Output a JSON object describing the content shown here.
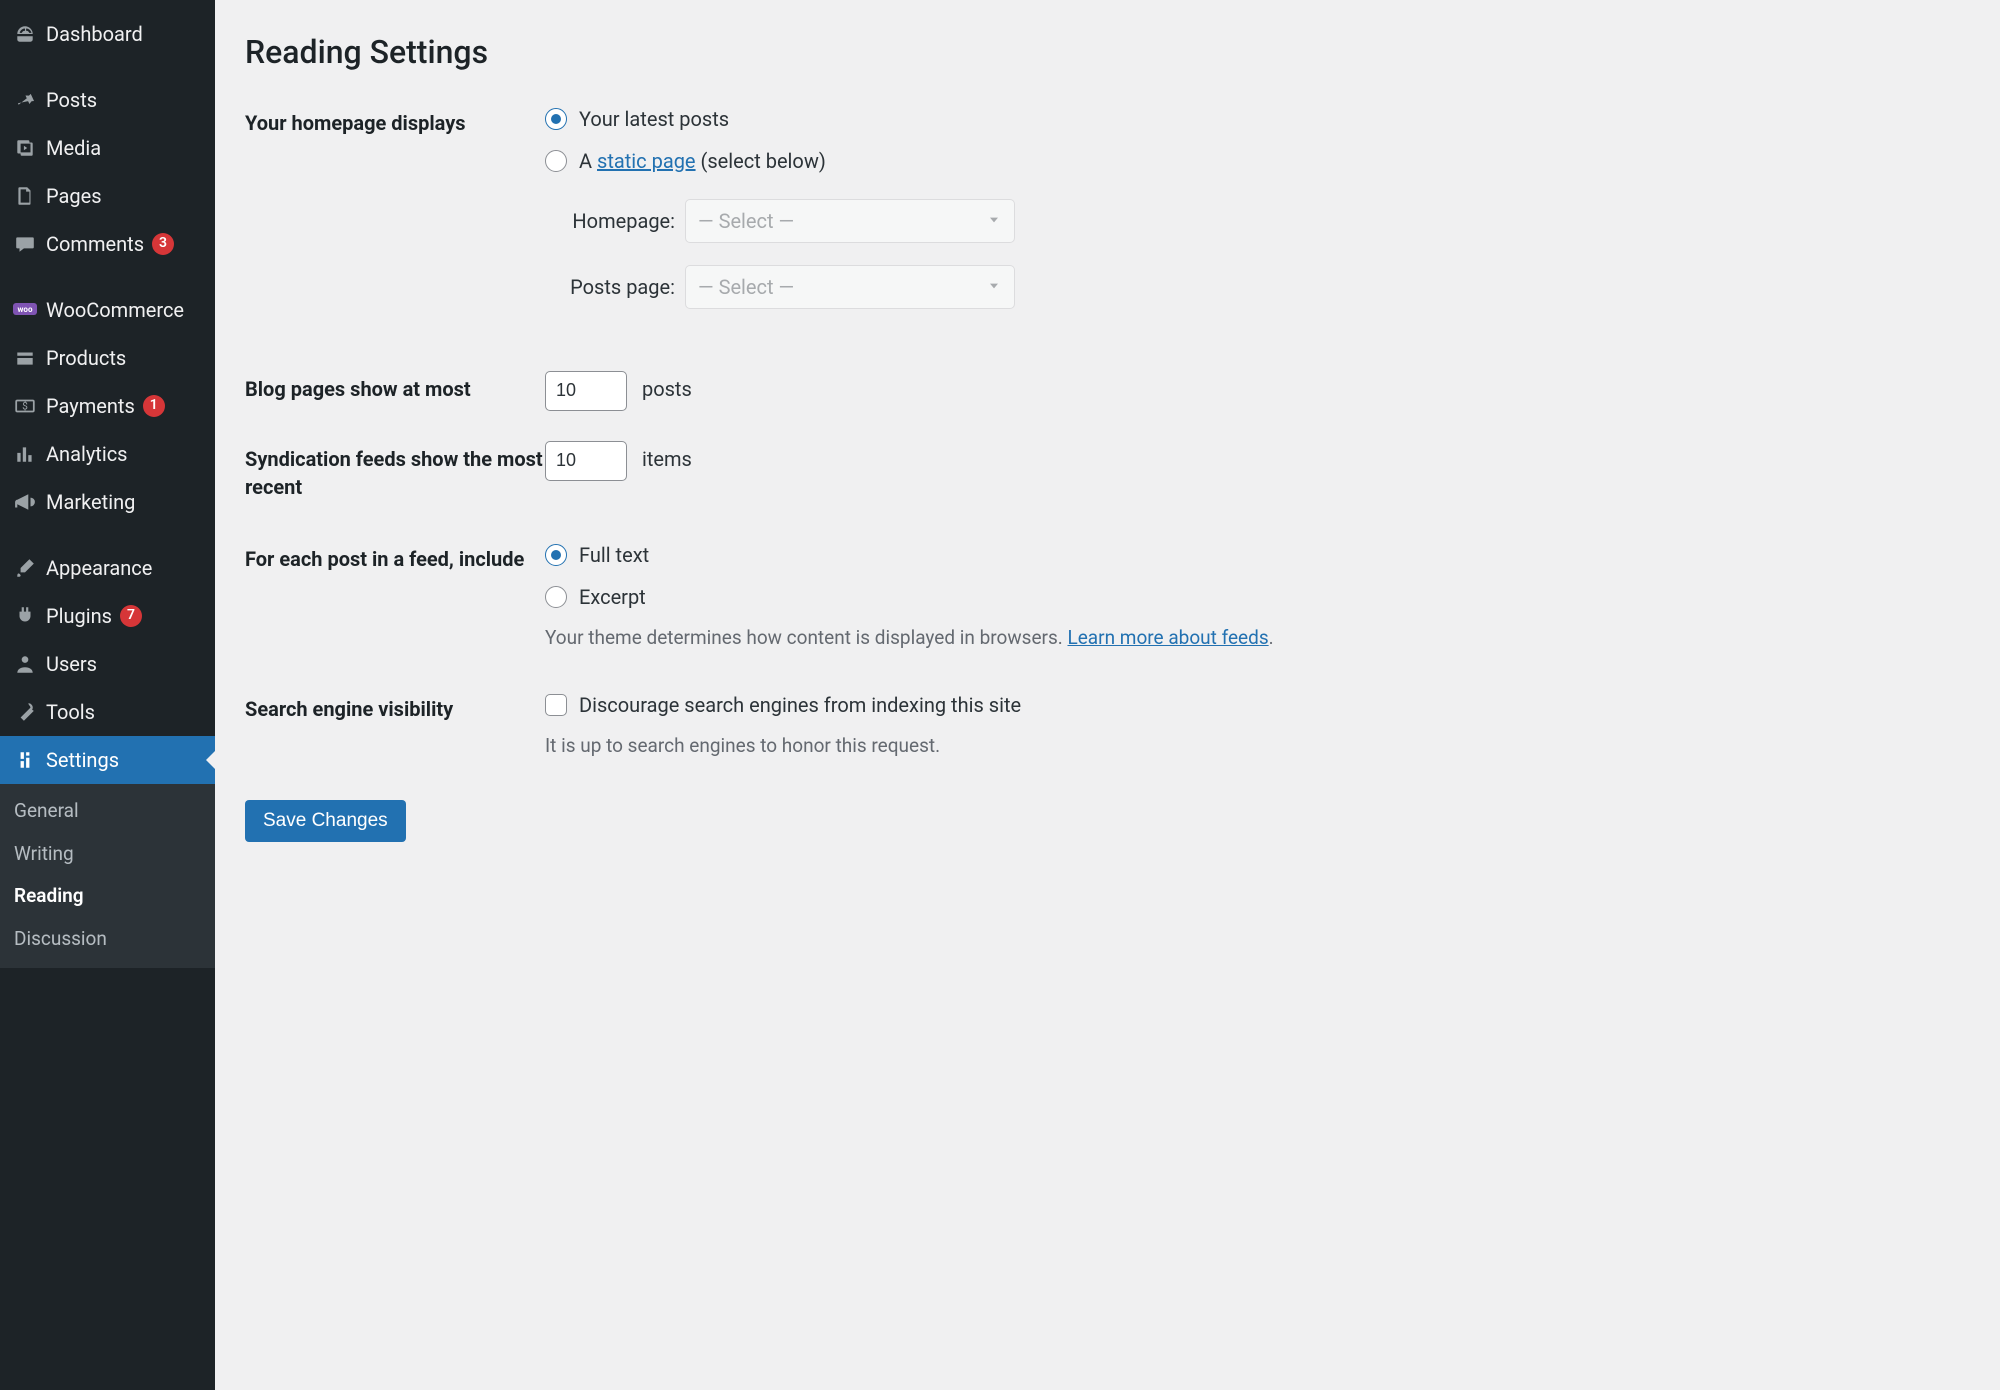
{
  "page": {
    "title": "Reading Settings",
    "save_button": "Save Changes"
  },
  "sidebar": {
    "items": [
      {
        "label": "Dashboard"
      },
      {
        "label": "Posts"
      },
      {
        "label": "Media"
      },
      {
        "label": "Pages"
      },
      {
        "label": "Comments",
        "badge": "3"
      },
      {
        "label": "WooCommerce"
      },
      {
        "label": "Products"
      },
      {
        "label": "Payments",
        "badge": "1"
      },
      {
        "label": "Analytics"
      },
      {
        "label": "Marketing"
      },
      {
        "label": "Appearance"
      },
      {
        "label": "Plugins",
        "badge": "7"
      },
      {
        "label": "Users"
      },
      {
        "label": "Tools"
      },
      {
        "label": "Settings"
      }
    ],
    "submenu": [
      {
        "label": "General"
      },
      {
        "label": "Writing"
      },
      {
        "label": "Reading"
      },
      {
        "label": "Discussion"
      }
    ]
  },
  "form": {
    "homepage": {
      "heading": "Your homepage displays",
      "opt_latest": "Your latest posts",
      "opt_static_prefix": "A ",
      "opt_static_link": "static page",
      "opt_static_suffix": " (select below)",
      "homepage_label": "Homepage:",
      "posts_page_label": "Posts page:",
      "select_placeholder": "— Select —"
    },
    "blog_pages": {
      "heading": "Blog pages show at most",
      "value": "10",
      "suffix": "posts"
    },
    "syndication": {
      "heading": "Syndication feeds show the most recent",
      "value": "10",
      "suffix": "items"
    },
    "feed_content": {
      "heading": "For each post in a feed, include",
      "opt_full": "Full text",
      "opt_excerpt": "Excerpt",
      "description_prefix": "Your theme determines how content is displayed in browsers. ",
      "description_link": "Learn more about feeds",
      "description_suffix": "."
    },
    "seo": {
      "heading": "Search engine visibility",
      "checkbox_label": "Discourage search engines from indexing this site",
      "description": "It is up to search engines to honor this request."
    }
  }
}
